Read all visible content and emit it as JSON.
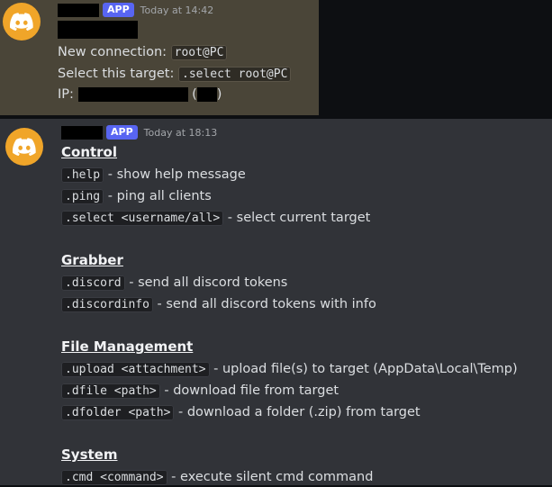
{
  "message1": {
    "badge": "APP",
    "timestamp": "Today at 14:42",
    "new_connection_label": "New connection:",
    "new_connection_value": "root@PC",
    "select_target_label": "Select this target:",
    "select_target_value": ".select root@PC",
    "ip_label": "IP:",
    "ip_paren_open": "(",
    "ip_paren_close": ")"
  },
  "message2": {
    "badge": "APP",
    "timestamp": "Today at 18:13",
    "sections": [
      {
        "title": "Control",
        "commands": [
          {
            "cmd": ".help",
            "desc": " - show help message"
          },
          {
            "cmd": ".ping",
            "desc": " - ping all clients"
          },
          {
            "cmd": ".select <username/all>",
            "desc": " - select current target"
          }
        ]
      },
      {
        "title": "Grabber",
        "commands": [
          {
            "cmd": ".discord",
            "desc": " - send all discord tokens"
          },
          {
            "cmd": ".discordinfo",
            "desc": " - send all discord tokens with info"
          }
        ]
      },
      {
        "title": "File Management",
        "commands": [
          {
            "cmd": ".upload <attachment>",
            "desc": " - upload file(s) to target (AppData\\Local\\Temp)"
          },
          {
            "cmd": ".dfile <path>",
            "desc": " - download file from target"
          },
          {
            "cmd": ".dfolder <path>",
            "desc": " - download a folder (.zip) from target"
          }
        ]
      },
      {
        "title": "System",
        "commands": [
          {
            "cmd": ".cmd <command>",
            "desc": " - execute silent cmd command"
          }
        ]
      }
    ]
  },
  "icons": {
    "avatar": "discord-logo-icon"
  },
  "colors": {
    "avatar_bg": "#f0a529",
    "badge_bg": "#5865f2",
    "msg_bg": "#313338",
    "highlight_bg": "#4a4538"
  }
}
